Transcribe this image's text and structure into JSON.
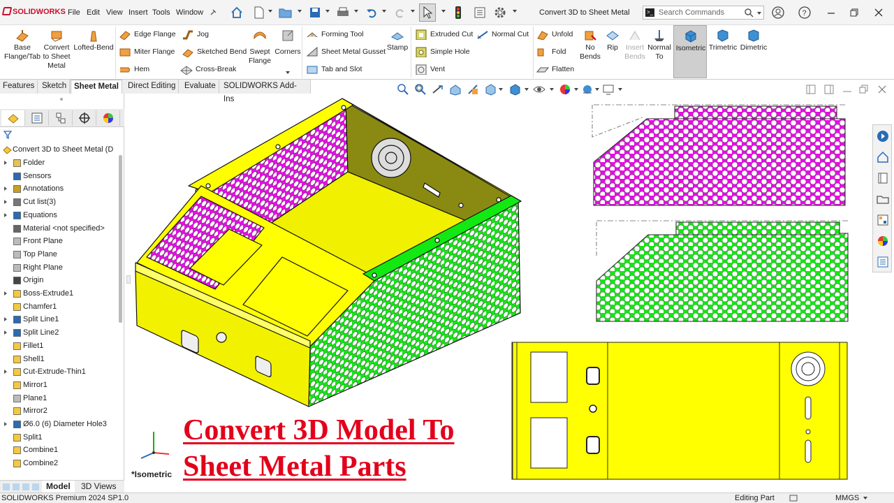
{
  "app": {
    "brand": "SOLIDWORKS",
    "menus": [
      "File",
      "Edit",
      "View",
      "Insert",
      "Tools",
      "Window"
    ],
    "document_title": "Convert 3D to Sheet Metal",
    "search_placeholder": "Search Commands"
  },
  "ribbon": {
    "big_buttons": [
      {
        "label": "Base\nFlange/Tab"
      },
      {
        "label": "Convert\nto Sheet\nMetal"
      },
      {
        "label": "Lofted-Bend"
      }
    ],
    "col1": [
      "Edge Flange",
      "Miter Flange",
      "Hem"
    ],
    "col2": [
      "Jog",
      "Sketched Bend",
      "Cross-Break"
    ],
    "swept": "Swept\nFlange",
    "corners": "Corners",
    "col3": [
      "Forming Tool",
      "Sheet Metal Gusset",
      "Tab and Slot"
    ],
    "stamp": "Stamp",
    "col4": [
      "Extruded Cut",
      "Simple Hole",
      "Vent"
    ],
    "normal_cut": "Normal Cut",
    "col5": [
      "Unfold",
      "Fold",
      "Flatten"
    ],
    "no_bends": "No\nBends",
    "rip": "Rip",
    "insert_bends": "Insert\nBends",
    "normal_to": "Normal\nTo",
    "views": [
      "Isometric",
      "Trimetric",
      "Dimetric"
    ]
  },
  "tabs": [
    "Features",
    "Sketch",
    "Sheet Metal",
    "Direct Editing",
    "Evaluate",
    "SOLIDWORKS Add-Ins"
  ],
  "active_tab": "Sheet Metal",
  "tree": {
    "root": "Convert 3D to Sheet Metal (D",
    "items": [
      {
        "label": "Folder",
        "icon": "folder-icon",
        "arrow": true
      },
      {
        "label": "Sensors",
        "icon": "sensor-icon",
        "arrow": false
      },
      {
        "label": "Annotations",
        "icon": "annotation-icon",
        "arrow": true
      },
      {
        "label": "Cut list(3)",
        "icon": "cutlist-icon",
        "arrow": true
      },
      {
        "label": "Equations",
        "icon": "equation-icon",
        "arrow": true
      },
      {
        "label": "Material <not specified>",
        "icon": "material-icon",
        "arrow": false
      },
      {
        "label": "Front Plane",
        "icon": "plane-icon",
        "arrow": false
      },
      {
        "label": "Top Plane",
        "icon": "plane-icon",
        "arrow": false
      },
      {
        "label": "Right Plane",
        "icon": "plane-icon",
        "arrow": false
      },
      {
        "label": "Origin",
        "icon": "origin-icon",
        "arrow": false
      },
      {
        "label": "Boss-Extrude1",
        "icon": "feature-icon",
        "arrow": true
      },
      {
        "label": "Chamfer1",
        "icon": "feature-icon",
        "arrow": false
      },
      {
        "label": "Split Line1",
        "icon": "splitline-icon",
        "arrow": true
      },
      {
        "label": "Split Line2",
        "icon": "splitline-icon",
        "arrow": true
      },
      {
        "label": "Fillet1",
        "icon": "feature-icon",
        "arrow": false
      },
      {
        "label": "Shell1",
        "icon": "feature-icon",
        "arrow": false
      },
      {
        "label": "Cut-Extrude-Thin1",
        "icon": "feature-icon",
        "arrow": true
      },
      {
        "label": "Mirror1",
        "icon": "mirror-icon",
        "arrow": false
      },
      {
        "label": "Plane1",
        "icon": "plane-icon",
        "arrow": false
      },
      {
        "label": "Mirror2",
        "icon": "mirror-icon",
        "arrow": false
      },
      {
        "label": "Ø6.0 (6) Diameter Hole3",
        "icon": "hole-icon",
        "arrow": true
      },
      {
        "label": "Split1",
        "icon": "feature-icon",
        "arrow": false
      },
      {
        "label": "Combine1",
        "icon": "feature-icon",
        "arrow": false
      },
      {
        "label": "Combine2",
        "icon": "feature-icon",
        "arrow": false
      }
    ]
  },
  "bottom_tabs": [
    "Model",
    "3D Views"
  ],
  "status": {
    "left": "SOLIDWORKS Premium 2024 SP1.0",
    "mode": "Editing Part",
    "units": "MMGS"
  },
  "viewport": {
    "view_label": "*Isometric",
    "overlay_title_line1": "Convert 3D Model To",
    "overlay_title_line2": "Sheet Metal Parts"
  },
  "colors": {
    "magenta": "#e60de6",
    "green": "#12e812",
    "yellow": "#ffff00",
    "title_red": "#e3001b"
  }
}
